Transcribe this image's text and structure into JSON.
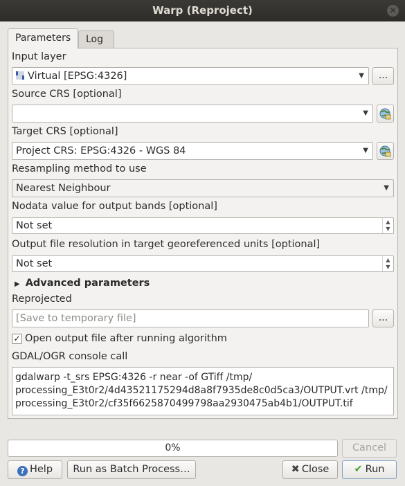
{
  "window": {
    "title": "Warp (Reproject)"
  },
  "tabs": [
    {
      "label": "Parameters"
    },
    {
      "label": "Log"
    }
  ],
  "params": {
    "input_layer": {
      "label": "Input layer",
      "value": "Virtual [EPSG:4326]",
      "browse": "..."
    },
    "source_crs": {
      "label": "Source CRS [optional]",
      "value": ""
    },
    "target_crs": {
      "label": "Target CRS [optional]",
      "value": "Project CRS: EPSG:4326 - WGS 84"
    },
    "resampling": {
      "label": "Resampling method to use",
      "value": "Nearest Neighbour"
    },
    "nodata": {
      "label": "Nodata value for output bands [optional]",
      "value": "Not set"
    },
    "resolution": {
      "label": "Output file resolution in target georeferenced units [optional]",
      "value": "Not set"
    },
    "advanced": {
      "label": "Advanced parameters"
    },
    "reprojected": {
      "label": "Reprojected",
      "placeholder": "[Save to temporary file]",
      "browse": "..."
    },
    "open_output": {
      "label": "Open output file after running algorithm",
      "checked": true
    },
    "console": {
      "label": "GDAL/OGR console call",
      "text": "gdalwarp -t_srs EPSG:4326 -r near -of GTiff /tmp/\nprocessing_E3t0r2/4d43521175294d8a8f7935de8c0d5ca3/OUTPUT.vrt /tmp/\nprocessing_E3t0r2/cf35f6625870499798aa2930475ab4b1/OUTPUT.tif"
    }
  },
  "footer": {
    "progress": "0%",
    "cancel": "Cancel",
    "help": "Help",
    "batch": "Run as Batch Process…",
    "close": "Close",
    "run": "Run"
  }
}
